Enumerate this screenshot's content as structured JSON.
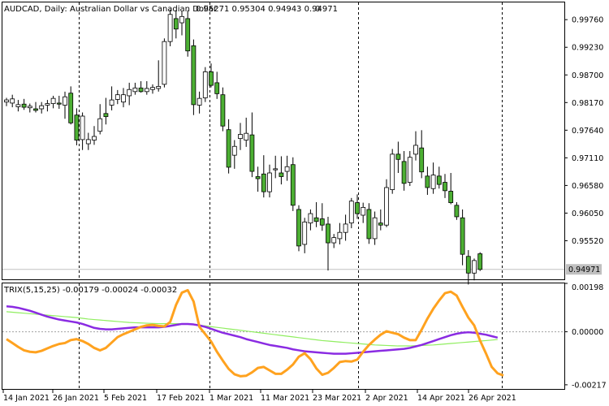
{
  "main_header": {
    "symbol": "AUDCAD, Daily:",
    "description": "Australian Dollar vs Canadian Dollar",
    "ohlc": "0.95271 0.95304 0.94943 0.94971",
    "extra": "0"
  },
  "indicator_header": {
    "text": "TRIX(5,15,25) -0.00179 -0.00024 -0.00032"
  },
  "colors": {
    "background": "#ffffff",
    "bull_fill": "#4caf33",
    "bear_fill": "#ffffff",
    "candle_border": "#000000",
    "trix_line": "#ffa21f",
    "signal_line": "#8a2be2",
    "signal2_line": "#90ee60",
    "current_price_line": "#c0c0c0",
    "current_price_label_bg": "#c0c0c0"
  },
  "price_axis": {
    "ticks": [
      "0.99760",
      "0.99230",
      "0.98700",
      "0.98170",
      "0.97640",
      "0.97110",
      "0.96580",
      "0.96050",
      "0.95520"
    ],
    "current_price": "0.94971"
  },
  "indicator_axis": {
    "ticks": [
      "0.00198",
      "0.00000",
      "-0.00217"
    ]
  },
  "time_axis": {
    "labels": [
      "14 Jan 2021",
      "26 Jan 2021",
      "5 Feb 2021",
      "17 Feb 2021",
      "1 Mar 2021",
      "11 Mar 2021",
      "23 Mar 2021",
      "2 Apr 2021",
      "14 Apr 2021",
      "26 Apr 2021"
    ]
  },
  "chart_data": [
    {
      "type": "candlestick",
      "title": "AUDCAD, Daily:  Australian Dollar vs Canadian Dollar",
      "y_ticks": [
        0.9976,
        0.9923,
        0.987,
        0.9817,
        0.9764,
        0.9711,
        0.9658,
        0.9605,
        0.9552
      ],
      "ylim": [
        0.9478,
        1.0009
      ],
      "current_price": 0.94971,
      "candles": [
        [
          0.9818,
          0.9826,
          0.981,
          0.9822
        ],
        [
          0.9816,
          0.9832,
          0.9808,
          0.9824
        ],
        [
          0.9809,
          0.9822,
          0.98,
          0.9813
        ],
        [
          0.9814,
          0.9824,
          0.9803,
          0.9808
        ],
        [
          0.9807,
          0.9815,
          0.9798,
          0.981
        ],
        [
          0.9805,
          0.9818,
          0.9798,
          0.9802
        ],
        [
          0.9805,
          0.9818,
          0.9796,
          0.9811
        ],
        [
          0.9812,
          0.9822,
          0.98,
          0.9815
        ],
        [
          0.9815,
          0.983,
          0.9806,
          0.9825
        ],
        [
          0.9816,
          0.983,
          0.9805,
          0.9814
        ],
        [
          0.9812,
          0.9838,
          0.9786,
          0.9828
        ],
        [
          0.9835,
          0.9848,
          0.9775,
          0.9778
        ],
        [
          0.9793,
          0.9806,
          0.9735,
          0.9745
        ],
        [
          0.9746,
          0.9798,
          0.9726,
          0.9791
        ],
        [
          0.9738,
          0.9759,
          0.9726,
          0.9746
        ],
        [
          0.9745,
          0.9772,
          0.9736,
          0.9752
        ],
        [
          0.9762,
          0.9814,
          0.9756,
          0.9786
        ],
        [
          0.9796,
          0.9826,
          0.9775,
          0.979
        ],
        [
          0.9812,
          0.9848,
          0.9802,
          0.9822
        ],
        [
          0.9823,
          0.9841,
          0.9814,
          0.9832
        ],
        [
          0.9818,
          0.9845,
          0.9808,
          0.9832
        ],
        [
          0.983,
          0.9855,
          0.9812,
          0.9842
        ],
        [
          0.9838,
          0.9855,
          0.9832,
          0.9845
        ],
        [
          0.9845,
          0.9858,
          0.9836,
          0.9838
        ],
        [
          0.9838,
          0.9858,
          0.9832,
          0.9844
        ],
        [
          0.9842,
          0.9852,
          0.9834,
          0.9846
        ],
        [
          0.9844,
          0.9898,
          0.9838,
          0.9848
        ],
        [
          0.9852,
          0.994,
          0.9846,
          0.9934
        ],
        [
          0.9934,
          0.9995,
          0.9925,
          0.9986
        ],
        [
          0.9978,
          0.9994,
          0.994,
          0.9958
        ],
        [
          0.997,
          0.9992,
          0.9946,
          0.9982
        ],
        [
          0.9978,
          0.9994,
          0.9905,
          0.9916
        ],
        [
          0.9926,
          0.9938,
          0.9793,
          0.9813
        ],
        [
          0.9812,
          0.9838,
          0.9796,
          0.9825
        ],
        [
          0.9826,
          0.9885,
          0.9818,
          0.9876
        ],
        [
          0.9876,
          0.9892,
          0.9846,
          0.985
        ],
        [
          0.9855,
          0.9876,
          0.9824,
          0.9834
        ],
        [
          0.9832,
          0.9846,
          0.9762,
          0.9772
        ],
        [
          0.9765,
          0.9785,
          0.9681,
          0.9693
        ],
        [
          0.9716,
          0.9745,
          0.969,
          0.9733
        ],
        [
          0.9748,
          0.9778,
          0.9726,
          0.9756
        ],
        [
          0.9745,
          0.9788,
          0.9732,
          0.9758
        ],
        [
          0.9755,
          0.9798,
          0.9674,
          0.9685
        ],
        [
          0.9675,
          0.9694,
          0.9646,
          0.9671
        ],
        [
          0.968,
          0.9716,
          0.9635,
          0.9646
        ],
        [
          0.9646,
          0.9698,
          0.9635,
          0.9682
        ],
        [
          0.9688,
          0.9715,
          0.9672,
          0.969
        ],
        [
          0.9682,
          0.9714,
          0.966,
          0.9675
        ],
        [
          0.9685,
          0.9715,
          0.9667,
          0.9694
        ],
        [
          0.9698,
          0.9712,
          0.9609,
          0.962
        ],
        [
          0.9612,
          0.962,
          0.9532,
          0.9542
        ],
        [
          0.9545,
          0.9596,
          0.9528,
          0.9588
        ],
        [
          0.9586,
          0.9612,
          0.9572,
          0.9604
        ],
        [
          0.9596,
          0.9626,
          0.9578,
          0.9589
        ],
        [
          0.9594,
          0.9624,
          0.9571,
          0.9582
        ],
        [
          0.9584,
          0.9598,
          0.9495,
          0.9548
        ],
        [
          0.9548,
          0.9565,
          0.9538,
          0.9558
        ],
        [
          0.9556,
          0.9586,
          0.9545,
          0.9568
        ],
        [
          0.9568,
          0.9602,
          0.9552,
          0.9584
        ],
        [
          0.9586,
          0.9634,
          0.9576,
          0.9628
        ],
        [
          0.9625,
          0.9641,
          0.9594,
          0.9604
        ],
        [
          0.9601,
          0.9625,
          0.9586,
          0.9616
        ],
        [
          0.9612,
          0.9624,
          0.9546,
          0.9556
        ],
        [
          0.9556,
          0.9608,
          0.9544,
          0.9596
        ],
        [
          0.9586,
          0.9612,
          0.9572,
          0.9582
        ],
        [
          0.9582,
          0.967,
          0.9578,
          0.9654
        ],
        [
          0.965,
          0.9728,
          0.9642,
          0.9718
        ],
        [
          0.9718,
          0.9742,
          0.9682,
          0.9708
        ],
        [
          0.9704,
          0.9724,
          0.9648,
          0.9662
        ],
        [
          0.9664,
          0.9724,
          0.9657,
          0.9712
        ],
        [
          0.9718,
          0.9762,
          0.9706,
          0.9735
        ],
        [
          0.973,
          0.9764,
          0.9672,
          0.9684
        ],
        [
          0.9676,
          0.9694,
          0.964,
          0.9654
        ],
        [
          0.9652,
          0.9702,
          0.9642,
          0.9678
        ],
        [
          0.9676,
          0.9694,
          0.9652,
          0.966
        ],
        [
          0.9664,
          0.968,
          0.9634,
          0.9648
        ],
        [
          0.9647,
          0.9682,
          0.9622,
          0.9625
        ],
        [
          0.962,
          0.9626,
          0.9592,
          0.9598
        ],
        [
          0.9596,
          0.9612,
          0.9505,
          0.9526
        ],
        [
          0.9522,
          0.9534,
          0.9468,
          0.949
        ],
        [
          0.949,
          0.9518,
          0.9476,
          0.9514
        ],
        [
          0.9527,
          0.953,
          0.9494,
          0.9497
        ]
      ]
    },
    {
      "type": "line",
      "title": "TRIX(5,15,25) -0.00179 -0.00024 -0.00032",
      "y_ticks": [
        0.00198,
        0.0,
        -0.00217
      ],
      "ylim": [
        -0.00234,
        0.00198
      ],
      "series": [
        {
          "color": "#ffa21f",
          "values": [
            -0.0003,
            -0.00046,
            -0.00062,
            -0.00076,
            -0.00082,
            -0.00084,
            -0.00078,
            -0.00068,
            -0.00058,
            -0.0005,
            -0.00046,
            -0.00034,
            -0.0003,
            -0.00038,
            -0.0005,
            -0.00066,
            -0.00076,
            -0.00066,
            -0.00044,
            -0.00022,
            -0.0001,
            0.0,
            0.0001,
            0.0002,
            0.00026,
            0.00028,
            0.00024,
            0.00022,
            0.0004,
            0.0011,
            0.0016,
            0.0017,
            0.00124,
            0.0002,
            -0.0001,
            -0.0004,
            -0.00082,
            -0.00118,
            -0.00152,
            -0.00174,
            -0.00182,
            -0.0018,
            -0.00166,
            -0.00148,
            -0.00144,
            -0.00158,
            -0.00172,
            -0.00172,
            -0.00155,
            -0.00134,
            -0.00102,
            -0.00088,
            -0.00112,
            -0.0015,
            -0.00176,
            -0.00168,
            -0.00148,
            -0.00124,
            -0.0012,
            -0.00122,
            -0.00114,
            -0.00082,
            -0.00054,
            -0.00032,
            -0.00012,
            2e-05,
            -4e-05,
            -0.0001,
            -0.00024,
            -0.00034,
            -0.00034,
            8e-05,
            0.00054,
            0.00094,
            0.00128,
            0.00158,
            0.00164,
            0.00148,
            0.00102,
            0.00058,
            0.00026,
            -0.00036,
            -0.00088,
            -0.00144,
            -0.0017,
            -0.00179
          ]
        },
        {
          "color": "#8a2be2",
          "values": [
            0.00104,
            0.00102,
            0.00098,
            0.00092,
            0.00086,
            0.00078,
            0.0007,
            0.00062,
            0.00056,
            0.0005,
            0.00046,
            0.00042,
            0.00038,
            0.00032,
            0.00024,
            0.00016,
            0.00012,
            0.0001,
            0.0001,
            0.00012,
            0.00014,
            0.00016,
            0.00018,
            0.00018,
            0.00018,
            0.00018,
            0.00018,
            0.0002,
            0.00024,
            0.00028,
            0.00032,
            0.00032,
            0.0003,
            0.00026,
            0.0002,
            0.00012,
            4e-05,
            -4e-05,
            -0.0001,
            -0.00016,
            -0.00022,
            -0.0003,
            -0.00036,
            -0.00042,
            -0.00048,
            -0.00054,
            -0.00058,
            -0.00062,
            -0.00066,
            -0.00072,
            -0.00076,
            -0.0008,
            -0.00082,
            -0.00084,
            -0.00086,
            -0.00088,
            -0.0009,
            -0.0009,
            -0.0009,
            -0.00088,
            -0.00086,
            -0.00084,
            -0.00082,
            -0.0008,
            -0.00078,
            -0.00076,
            -0.00074,
            -0.00072,
            -0.0007,
            -0.00066,
            -0.0006,
            -0.00054,
            -0.00046,
            -0.00038,
            -0.0003,
            -0.00022,
            -0.00014,
            -8e-05,
            -4e-05,
            -2e-05,
            -4e-05,
            -8e-05,
            -0.00012,
            -0.00018,
            -0.00024
          ]
        },
        {
          "color": "#90ee60",
          "values": [
            0.00082,
            0.0008,
            0.00078,
            0.00076,
            0.00074,
            0.00072,
            0.0007,
            0.00068,
            0.00066,
            0.00064,
            0.00062,
            0.0006,
            0.00058,
            0.00055,
            0.00052,
            0.0005,
            0.00048,
            0.00046,
            0.00044,
            0.00042,
            0.0004,
            0.00038,
            0.00037,
            0.00036,
            0.00035,
            0.00034,
            0.00033,
            0.00033,
            0.00033,
            0.00033,
            0.00033,
            0.00032,
            0.0003,
            0.00027,
            0.00024,
            0.00021,
            0.00018,
            0.00015,
            0.00012,
            9e-05,
            6e-05,
            3e-05,
            0.0,
            -3e-05,
            -6e-05,
            -9e-05,
            -0.00012,
            -0.00015,
            -0.00018,
            -0.00021,
            -0.00024,
            -0.00027,
            -0.0003,
            -0.00033,
            -0.00036,
            -0.00038,
            -0.0004,
            -0.00042,
            -0.00044,
            -0.00046,
            -0.00048,
            -0.0005,
            -0.00052,
            -0.00054,
            -0.00055,
            -0.00056,
            -0.00057,
            -0.00058,
            -0.00058,
            -0.00058,
            -0.00057,
            -0.00056,
            -0.00055,
            -0.00054,
            -0.00052,
            -0.0005,
            -0.00048,
            -0.00046,
            -0.00044,
            -0.00042,
            -0.0004,
            -0.00038,
            -0.00036,
            -0.00034,
            -0.00032
          ]
        }
      ]
    }
  ]
}
